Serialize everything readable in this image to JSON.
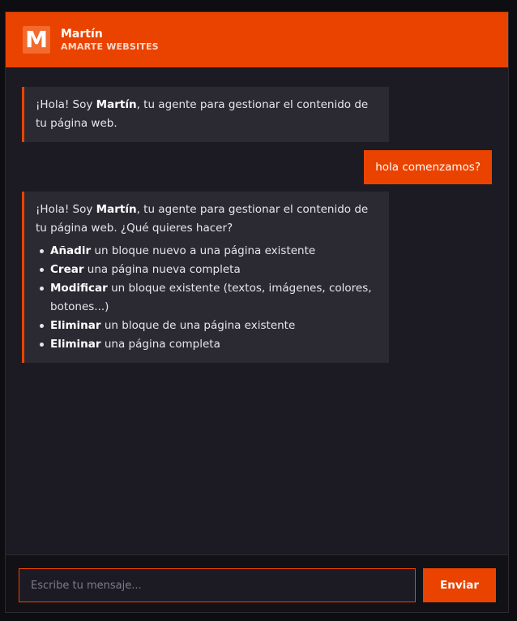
{
  "colors": {
    "accent": "#ea4300",
    "background": "#1c1b24",
    "bubble": "#2b2a32"
  },
  "header": {
    "logo_letter": "M",
    "logo_icon": "brand-logo-icon",
    "name": "Martín",
    "subtitle": "AMARTE WEBSITES"
  },
  "messages": [
    {
      "role": "bot",
      "intro_pre": "¡Hola! Soy ",
      "intro_bold": "Martín",
      "intro_post": ", tu agente para gestionar el contenido de tu página web."
    },
    {
      "role": "user",
      "text": "hola comenzamos?"
    },
    {
      "role": "bot",
      "intro_pre": "¡Hola! Soy ",
      "intro_bold": "Martín",
      "intro_post": ", tu agente para gestionar el contenido de tu página web. ¿Qué quieres hacer?",
      "items": [
        {
          "bold": "Añadir",
          "text": " un bloque nuevo a una página existente"
        },
        {
          "bold": "Crear",
          "text": " una página nueva completa"
        },
        {
          "bold": "Modificar",
          "text": " un bloque existente (textos, imágenes, colores, botones...)"
        },
        {
          "bold": "Eliminar",
          "text": " un bloque de una página existente"
        },
        {
          "bold": "Eliminar",
          "text": " una página completa"
        }
      ]
    }
  ],
  "composer": {
    "placeholder": "Escribe tu mensaje...",
    "value": "",
    "send_label": "Enviar"
  }
}
